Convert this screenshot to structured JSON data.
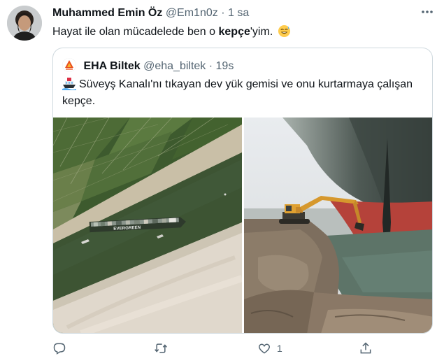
{
  "tweet": {
    "author_name": "Muhammed Emin Öz",
    "handle": "@Em1n0z",
    "separator": "·",
    "time": "1 sa",
    "text_before": "Hayat ile olan mücadelede ben o ",
    "text_bold": "kepçe",
    "text_after": "'yim.",
    "emoji": "sweat-smile-emoji"
  },
  "quoted": {
    "author_name": "EHA Biltek",
    "handle": "@eha_biltek",
    "separator": "·",
    "time": "19s",
    "emoji": "ship-emoji",
    "text": "Süveyş Kanalı'nı tıkayan dev yük gemisi ve onu kurtarmaya çalışan kepçe.",
    "images": [
      "aerial-canal-ship-photo",
      "excavator-ship-bow-photo"
    ],
    "ship_lettering": "EVERGREEN"
  },
  "actions": {
    "reply_icon": "reply-icon",
    "retweet_icon": "retweet-icon",
    "like_icon": "heart-icon",
    "like_count": "1",
    "share_icon": "share-icon",
    "more_icon": "more-icon"
  },
  "colors": {
    "text": "#0f1419",
    "muted": "#536471",
    "border": "#cfd9de"
  }
}
